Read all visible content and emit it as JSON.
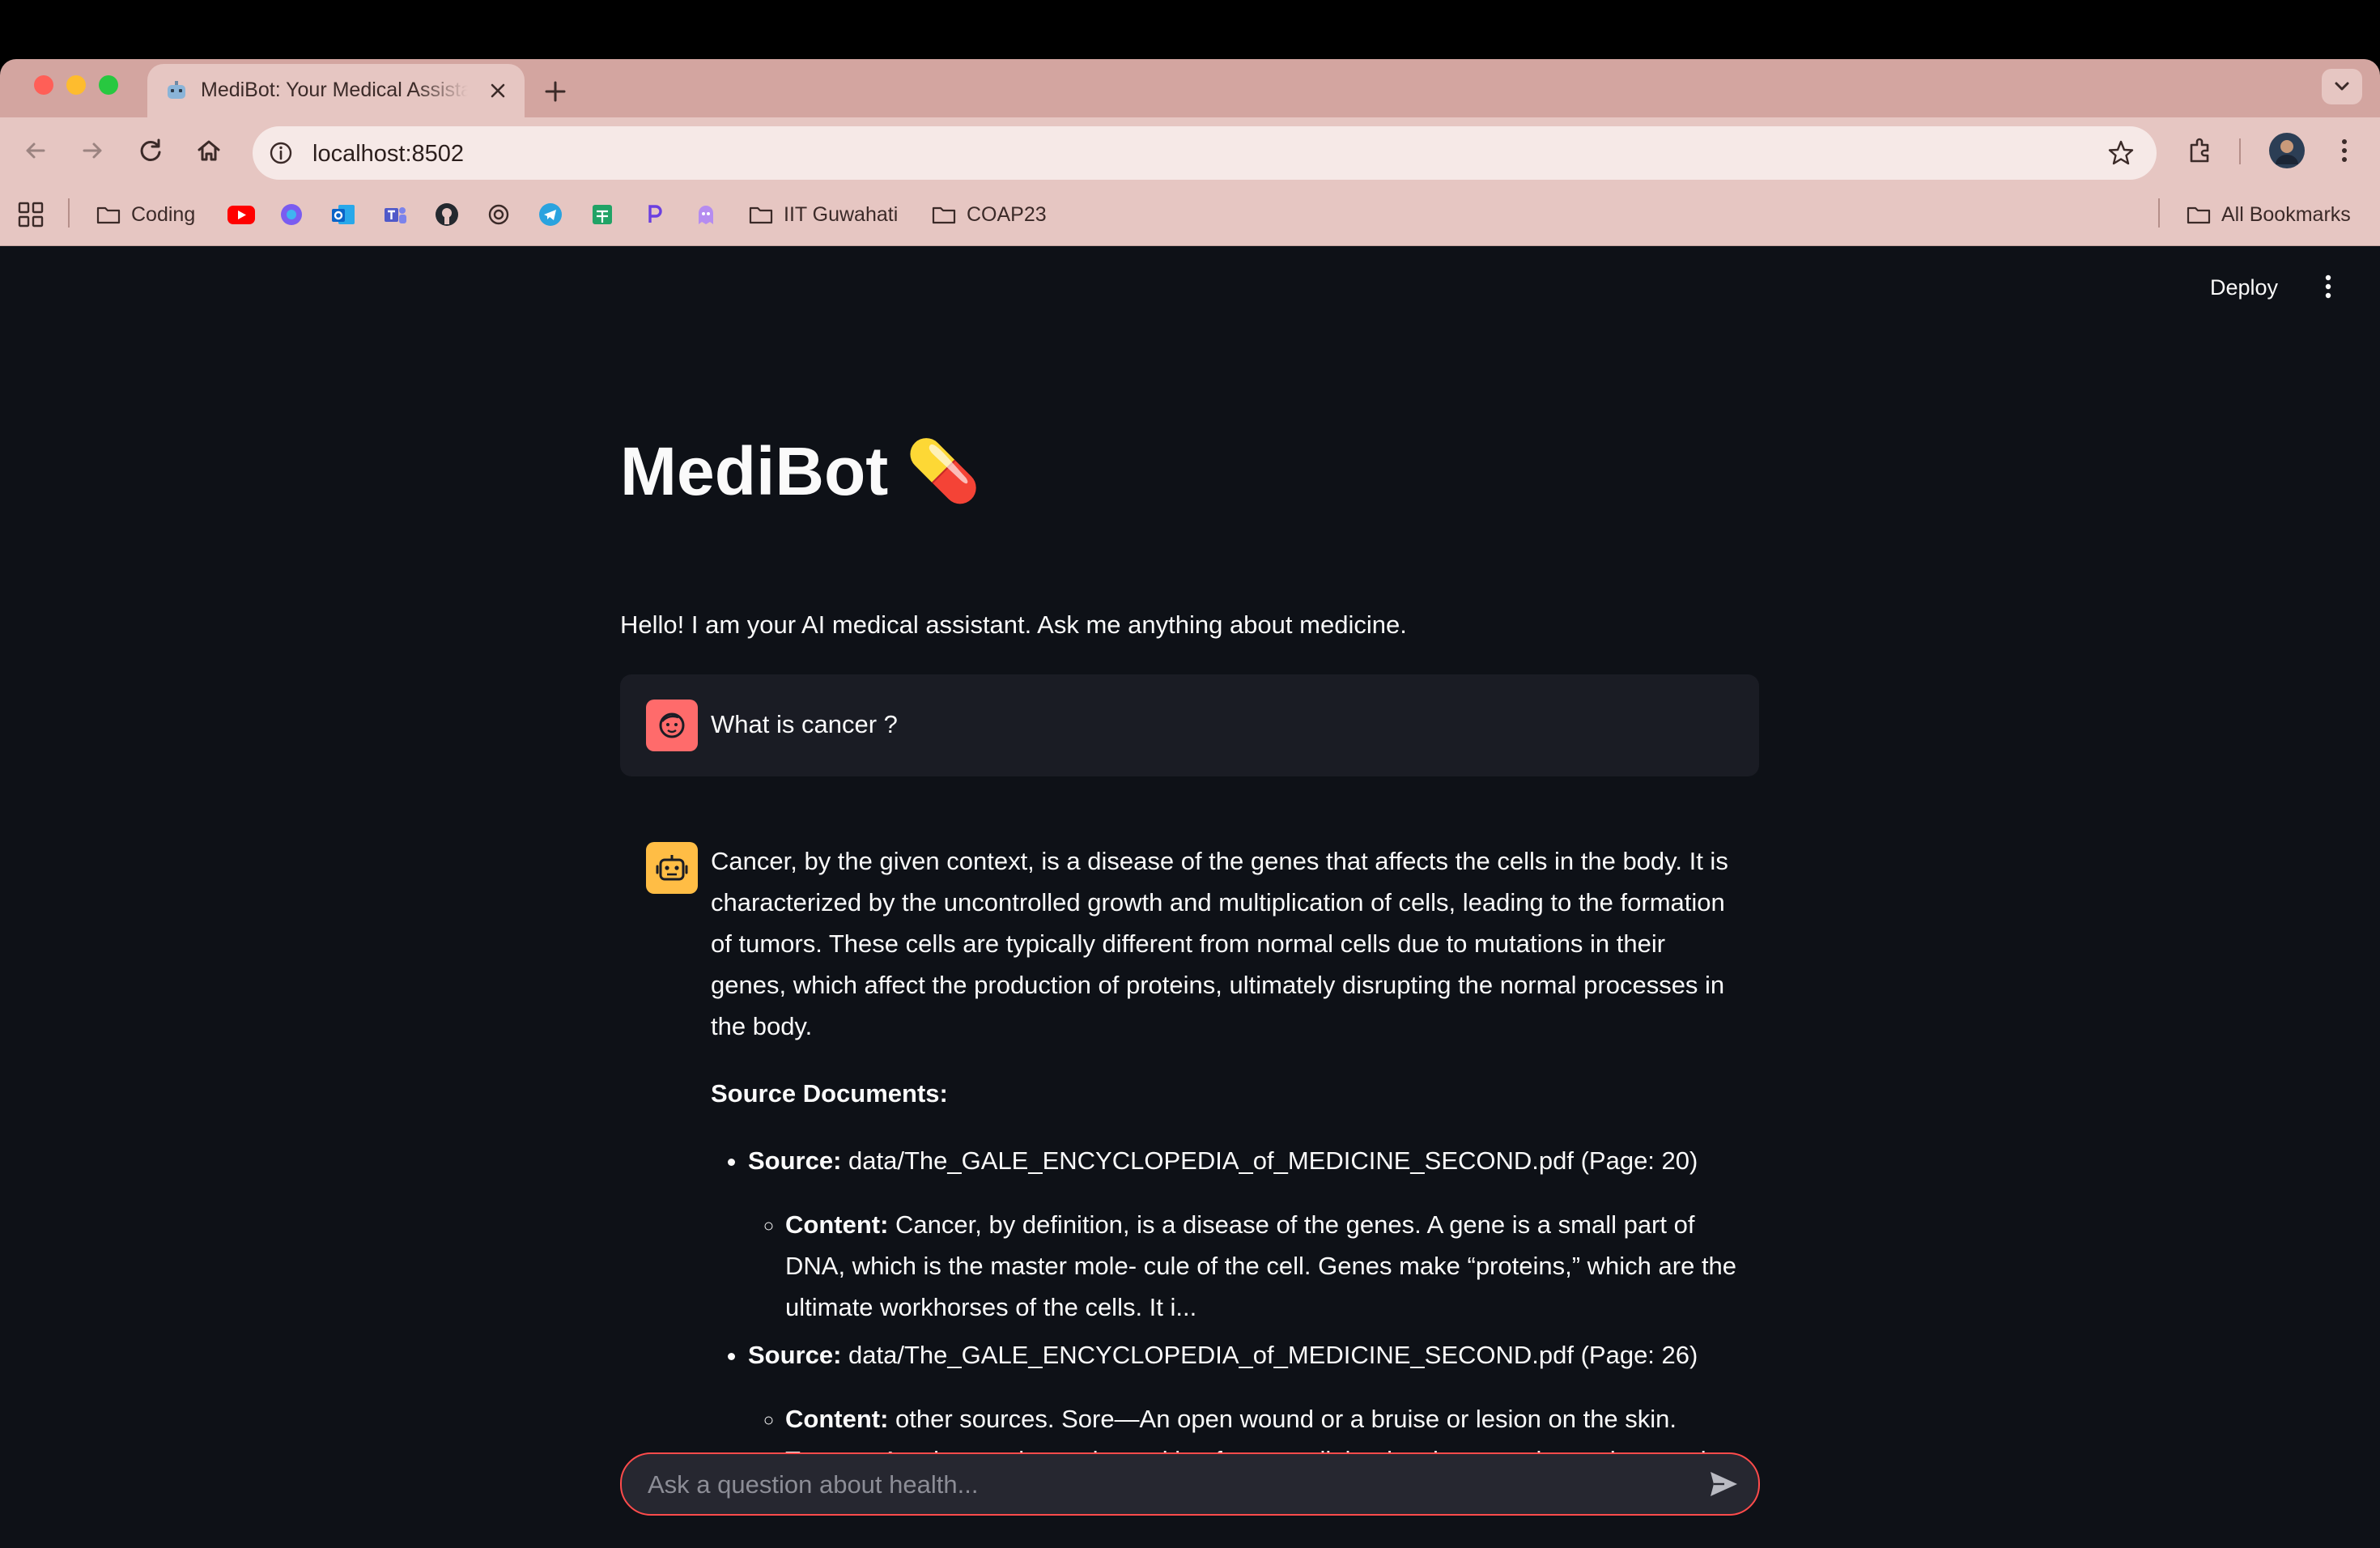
{
  "browser": {
    "tab_title": "MediBot: Your Medical Assistant",
    "url": "localhost:8502",
    "bookmarks": [
      {
        "label": "Coding"
      },
      {
        "label": "IIT Guwahati"
      },
      {
        "label": "COAP23"
      }
    ],
    "all_bookmarks_label": "All Bookmarks"
  },
  "app": {
    "deploy_label": "Deploy",
    "title": "MediBot",
    "title_emoji": "💊",
    "subtitle": "Hello! I am your AI medical assistant. Ask me anything about medicine.",
    "user_message": "What is cancer ?",
    "assistant": {
      "answer": "Cancer, by the given context, is a disease of the genes that affects the cells in the body. It is characterized by the uncontrolled growth and multiplication of cells, leading to the formation of tumors. These cells are typically different from normal cells due to mutations in their genes, which affect the production of proteins, ultimately disrupting the normal processes in the body.",
      "sources_heading": "Source Documents:",
      "source_label": "Source:",
      "content_label": "Content:",
      "sources": [
        {
          "source": "data/The_GALE_ENCYCLOPEDIA_of_MEDICINE_SECOND.pdf (Page: 20)",
          "content": "Cancer, by definition, is a disease of the genes. A gene is a small part of DNA, which is the master mole- cule of the cell. Genes make “proteins,” which are the ultimate workhorses of the cells. It i..."
        },
        {
          "source": "data/The_GALE_ENCYCLOPEDIA_of_MEDICINE_SECOND.pdf (Page: 26)",
          "content": "other sources. Sore—An open wound or a bruise or lesion on the skin. Tumor—An abnormal growth resulting from a cell that lost its normal growth control restraints and"
        }
      ]
    },
    "chat_placeholder": "Ask a question about health..."
  },
  "colors": {
    "app_bg": "#0e1117",
    "accent": "#ff4b4b",
    "user_avatar": "#ff6b6b",
    "assistant_avatar": "#ffbd45",
    "browser_frame": "#e6c6c2"
  }
}
